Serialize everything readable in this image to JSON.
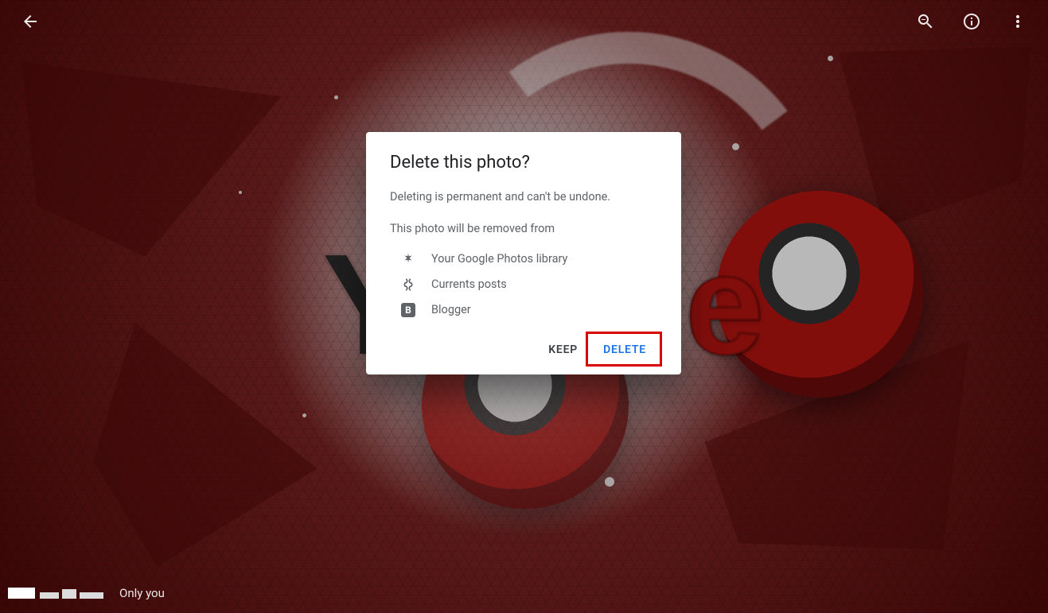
{
  "toolbar": {
    "back_aria": "Back",
    "zoom_aria": "Zoom out",
    "info_aria": "Information",
    "more_aria": "More options"
  },
  "dialog": {
    "title": "Delete this photo?",
    "warning": "Deleting is permanent and can't be undone.",
    "subheading": "This photo will be removed from",
    "items": [
      {
        "icon": "photos-icon",
        "label": "Your Google Photos library"
      },
      {
        "icon": "currents-icon",
        "label": "Currents posts"
      },
      {
        "icon": "blogger-icon",
        "label": "Blogger"
      }
    ],
    "keep_label": "KEEP",
    "delete_label": "DELETE"
  },
  "footer": {
    "visibility_label": "Only you"
  }
}
